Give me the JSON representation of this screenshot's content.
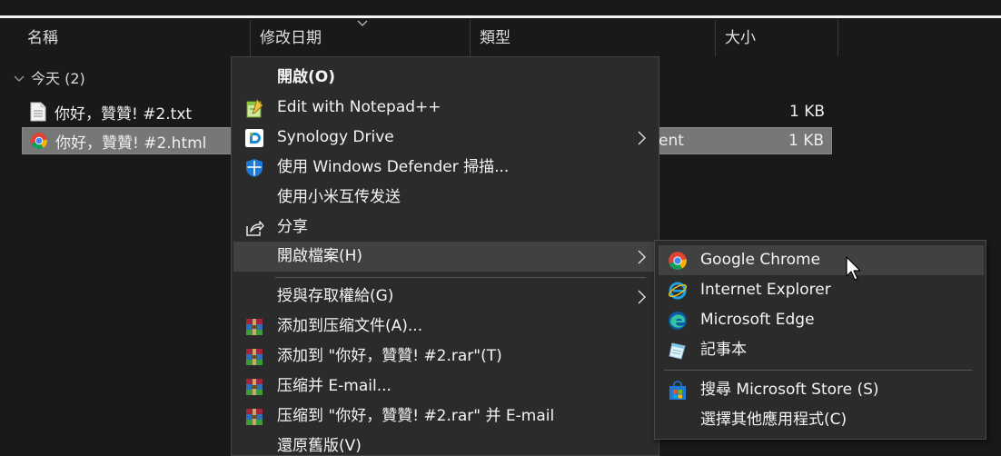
{
  "columns": {
    "name": "名稱",
    "date_modified": "修改日期",
    "type": "類型",
    "size": "大小"
  },
  "group": {
    "label": "今天 (2)"
  },
  "files": [
    {
      "name": "你好，贊贊! #2.txt",
      "type": "",
      "size": "1 KB",
      "icon": "text-file-icon",
      "selected": false
    },
    {
      "name": "你好，贊贊! #2.html",
      "type": "ent",
      "size": "1 KB",
      "icon": "chrome-icon",
      "selected": true
    }
  ],
  "context_menu": {
    "items": [
      {
        "label": "開啟(O)",
        "icon": "",
        "bold": true
      },
      {
        "label": "Edit with Notepad++",
        "icon": "notepad-plus-plus-icon"
      },
      {
        "label": "Synology Drive",
        "icon": "synology-drive-icon",
        "submenu": true
      },
      {
        "label": "使用 Windows Defender 掃描...",
        "icon": "windows-defender-icon"
      },
      {
        "label": "使用小米互传发送",
        "icon": ""
      },
      {
        "label": "分享",
        "icon": "share-icon"
      },
      {
        "label": "開啟檔案(H)",
        "icon": "",
        "submenu": true,
        "highlighted": true
      },
      {
        "label": "授與存取權給(G)",
        "icon": "",
        "submenu": true
      },
      {
        "label": "添加到压缩文件(A)...",
        "icon": "winrar-icon"
      },
      {
        "label": "添加到 \"你好，贊贊! #2.rar\"(T)",
        "icon": "winrar-icon"
      },
      {
        "label": "压缩并 E-mail...",
        "icon": "winrar-icon"
      },
      {
        "label": "压缩到 \"你好，贊贊! #2.rar\" 并 E-mail",
        "icon": "winrar-icon"
      },
      {
        "label": "還原舊版(V)",
        "icon": ""
      }
    ]
  },
  "open_with_submenu": {
    "items": [
      {
        "label": "Google Chrome",
        "icon": "chrome-icon",
        "highlighted": true
      },
      {
        "label": "Internet Explorer",
        "icon": "internet-explorer-icon"
      },
      {
        "label": "Microsoft Edge",
        "icon": "edge-icon"
      },
      {
        "label": "記事本",
        "icon": "notepad-icon"
      },
      {
        "label": "搜尋 Microsoft Store (S)",
        "icon": "microsoft-store-icon"
      },
      {
        "label": "選擇其他應用程式(C)",
        "icon": ""
      }
    ]
  },
  "colors": {
    "background": "#191919",
    "menu_background": "#2b2b2b",
    "menu_highlight": "#414141",
    "selected_row": "#777777"
  }
}
